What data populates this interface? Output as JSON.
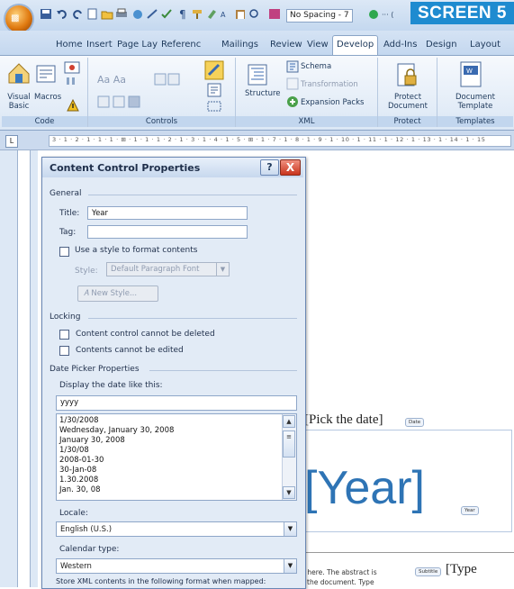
{
  "screen_label": "SCREEN 5",
  "app": {
    "style_box": "No Spacing - 7",
    "tabs": [
      "Home",
      "Insert",
      "Page Lay",
      "Referenc",
      "Mailings",
      "Review",
      "View",
      "Develop",
      "Add-Ins",
      "Design",
      "Layout"
    ],
    "active_tab": "Develop"
  },
  "ribbon": {
    "code": {
      "title": "Code",
      "visual_basic": "Visual Basic",
      "macros": "Macros"
    },
    "controls": {
      "title": "Controls"
    },
    "xml": {
      "title": "XML",
      "structure": "Structure",
      "schema": "Schema",
      "transformation": "Transformation",
      "expansion_packs": "Expansion Packs"
    },
    "protect": {
      "title": "Protect",
      "protect_document": "Protect Document"
    },
    "templates": {
      "title": "Templates",
      "document_template": "Document Template"
    }
  },
  "ruler_text": "3 · 1 · 2 · 1 · 1 · 1 · ⊞ · 1 · 1 · 1 · 2 · 1 · 3 · 1 · 4 · 1 · 5 · ⊞ · 1 · 7 · 1 · 8 · 1 · 9 · 1 · 10 · 1 · 11 · 1 · 12 · 1 · 13 · 1 · 14 · 1 · 15",
  "dialog": {
    "title": "Content Control Properties",
    "help": "?",
    "close": "X",
    "general": {
      "heading": "General",
      "title_label": "Title:",
      "title_value": "Year",
      "tag_label": "Tag:",
      "tag_value": "",
      "use_style_label": "Use a style to format contents",
      "style_label": "Style:",
      "style_value": "Default Paragraph Font",
      "new_style": "New Style..."
    },
    "locking": {
      "heading": "Locking",
      "cannot_delete": "Content control cannot be deleted",
      "cannot_edit": "Contents cannot be edited"
    },
    "date_picker": {
      "heading": "Date Picker Properties",
      "display_label": "Display the date like this:",
      "format_value": "yyyy",
      "formats": [
        "1/30/2008",
        "Wednesday, January 30, 2008",
        "January 30, 2008",
        "1/30/08",
        "2008-01-30",
        "30-Jan-08",
        "1.30.2008",
        "Jan. 30, 08"
      ],
      "locale_label": "Locale:",
      "locale_value": "English (U.S.)",
      "calendar_label": "Calendar type:",
      "calendar_value": "Western",
      "store_text": "Store XML contents in the following format when mapped:"
    }
  },
  "document": {
    "pick_date": "[Pick the date]",
    "date_tag": "Date",
    "year": "[Year]",
    "year_tag": "Year",
    "abstract_line1": "t here. The abstract is",
    "abstract_line2": "f the document. Type",
    "subtitle_tag": "Subtitle",
    "type_text": "[Type"
  }
}
